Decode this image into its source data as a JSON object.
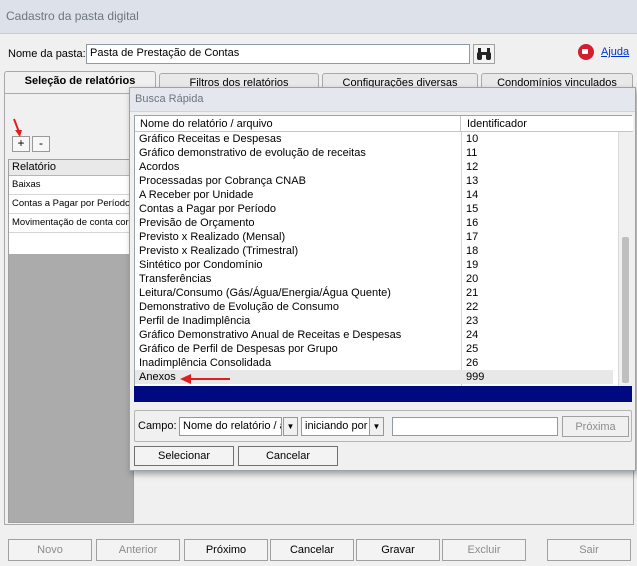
{
  "window": {
    "title": "Cadastro da pasta digital"
  },
  "folder": {
    "label": "Nome da pasta:",
    "value": "Pasta de Prestação de Contas",
    "search_icon": "binoculars-icon"
  },
  "help": {
    "icon": "help-video-icon",
    "label": "Ajuda"
  },
  "tabs": [
    {
      "label": "Seleção de relatórios"
    },
    {
      "label": "Filtros dos relatórios"
    },
    {
      "label": "Configurações diversas"
    },
    {
      "label": "Condomínios vinculados"
    }
  ],
  "report_buttons": {
    "add": "+",
    "remove": "-"
  },
  "report_list": {
    "header": "Relatório",
    "rows": [
      "Baixas",
      "Contas a Pagar por Período",
      "Movimentação de conta corre"
    ]
  },
  "bottom_buttons": [
    {
      "label": "Novo",
      "enabled": false
    },
    {
      "label": "Anterior",
      "enabled": false
    },
    {
      "label": "Próximo",
      "enabled": true
    },
    {
      "label": "Cancelar",
      "enabled": true
    },
    {
      "label": "Gravar",
      "enabled": true
    },
    {
      "label": "Excluir",
      "enabled": false
    },
    {
      "label": "Sair",
      "enabled": false
    }
  ],
  "dialog": {
    "title": "Busca Rápida",
    "columns": [
      "Nome do relatório / arquivo",
      "Identificador"
    ],
    "rows": [
      {
        "name": "Gráfico Receitas e Despesas",
        "id": "10"
      },
      {
        "name": "Gráfico demonstrativo de evolução de receitas",
        "id": "11"
      },
      {
        "name": "Acordos",
        "id": "12"
      },
      {
        "name": "Processadas por Cobrança CNAB",
        "id": "13"
      },
      {
        "name": "A Receber por Unidade",
        "id": "14"
      },
      {
        "name": "Contas a Pagar por Período",
        "id": "15"
      },
      {
        "name": "Previsão de Orçamento",
        "id": "16"
      },
      {
        "name": "Previsto x Realizado (Mensal)",
        "id": "17"
      },
      {
        "name": "Previsto x Realizado (Trimestral)",
        "id": "18"
      },
      {
        "name": "Sintético por Condomínio",
        "id": "19"
      },
      {
        "name": "Transferências",
        "id": "20"
      },
      {
        "name": "Leitura/Consumo (Gás/Água/Energia/Água Quente)",
        "id": "21"
      },
      {
        "name": "Demonstrativo de Evolução de Consumo",
        "id": "22"
      },
      {
        "name": "Perfil de Inadimplência",
        "id": "23"
      },
      {
        "name": "Gráfico Demonstrativo Anual de Receitas e Despesas",
        "id": "24"
      },
      {
        "name": "Gráfico de Perfil de Despesas por Grupo",
        "id": "25"
      },
      {
        "name": "Inadimplência Consolidada",
        "id": "26"
      },
      {
        "name": "Anexos",
        "id": "999"
      }
    ],
    "search": {
      "label": "Campo:",
      "field_value": "Nome do relatório / a",
      "mode_value": "iniciando por",
      "text_value": "",
      "next_label": "Próxima"
    },
    "select_label": "Selecionar",
    "cancel_label": "Cancelar"
  },
  "colors": {
    "accent_red": "#e02020",
    "selection_bar": "#000a80",
    "link": "#0033cc"
  }
}
